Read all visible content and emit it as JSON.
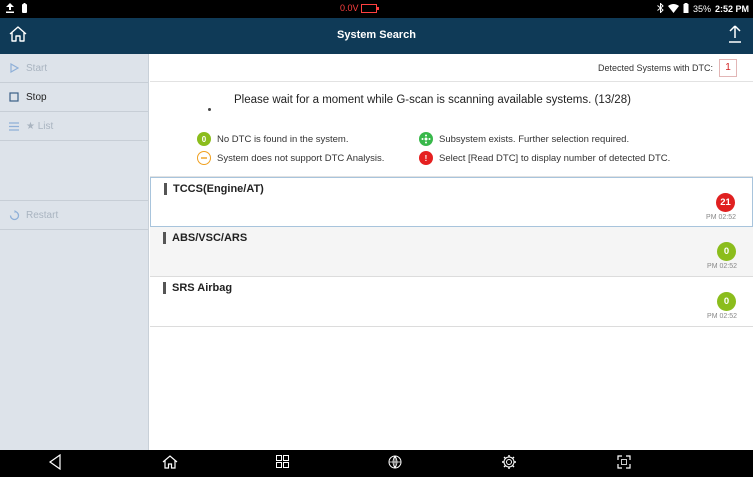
{
  "status_bar": {
    "left_icons": [
      "upload-icon",
      "battery-small-icon"
    ],
    "voltage": "0.0V",
    "right_icons": [
      "bluetooth-icon",
      "wifi-icon",
      "battery-icon"
    ],
    "battery_percent": "35%",
    "time": "2:52 PM"
  },
  "titlebar": {
    "title": "System Search"
  },
  "sidebar": {
    "start": "Start",
    "stop": "Stop",
    "list": "★ List",
    "restart": "Restart"
  },
  "detected": {
    "label": "Detected Systems with DTC:",
    "count": "1"
  },
  "message": "Please wait for a moment while G-scan is scanning available systems. (13/28)",
  "legend": {
    "no_dtc": "No DTC is found in the system.",
    "no_dtc_icon": "0",
    "not_support": "System does not support DTC Analysis.",
    "subsystem": "Subsystem exists. Further selection required.",
    "read_dtc": "Select [Read DTC] to display number of detected DTC."
  },
  "systems": [
    {
      "name": "TCCS(Engine/AT)",
      "count": "21",
      "time": "PM 02:52",
      "status": "red"
    },
    {
      "name": "ABS/VSC/ARS",
      "count": "0",
      "time": "PM 02:52",
      "status": "green"
    },
    {
      "name": "SRS Airbag",
      "count": "0",
      "time": "PM 02:52",
      "status": "green"
    }
  ],
  "colors": {
    "titlebar": "#0f3a57",
    "sidebar": "#dde3ea",
    "dtc_red": "#e02020",
    "ok_green": "#8bbd1c"
  }
}
